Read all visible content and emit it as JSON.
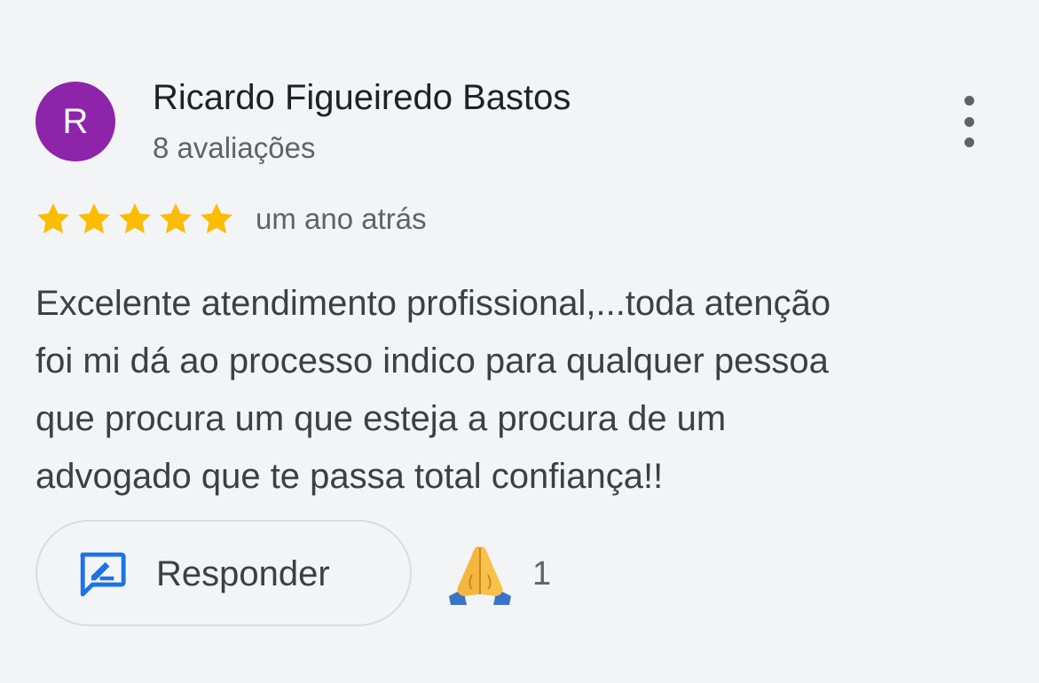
{
  "review": {
    "avatar_initial": "R",
    "avatar_color": "#8e24aa",
    "reviewer_name": "Ricardo Figueiredo Bastos",
    "review_count": "8 avaliações",
    "rating": 5,
    "rating_max": 5,
    "star_color": "#fbbc04",
    "time_ago": "um ano atrás",
    "text_lines": [
      "Excelente atendimento profissional,...toda atenção",
      "foi mi dá ao processo indico para qualquer pessoa",
      "que procura um que esteja a procura de um",
      "advogado que te passa total confiança!!"
    ]
  },
  "actions": {
    "reply_label": "Responder",
    "reply_icon": "reply-edit-icon",
    "reply_icon_color": "#1a73e8",
    "reaction_icon": "folded-hands-icon",
    "reaction_count": "1"
  },
  "menu": {
    "icon": "more-vertical-icon"
  }
}
